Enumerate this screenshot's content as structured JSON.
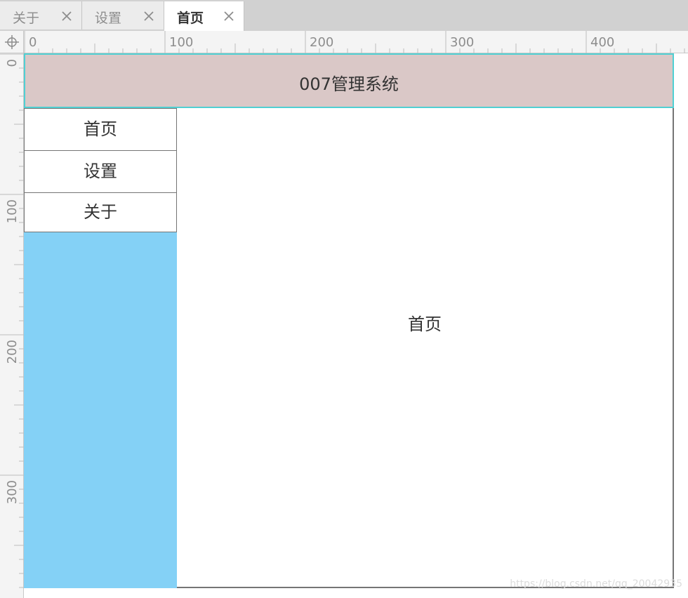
{
  "tabs": [
    {
      "label": "关于",
      "active": false
    },
    {
      "label": "设置",
      "active": false
    },
    {
      "label": "首页",
      "active": true
    }
  ],
  "ruler": {
    "horizontal_labels": [
      "0",
      "100",
      "200",
      "300",
      "400"
    ],
    "vertical_labels": [
      "0",
      "100",
      "200",
      "300"
    ]
  },
  "app": {
    "title": "007管理系统"
  },
  "sidebar": {
    "items": [
      {
        "label": "首页"
      },
      {
        "label": "设置"
      },
      {
        "label": "关于"
      }
    ]
  },
  "main": {
    "content": "首页"
  },
  "watermark": "https://blog.csdn.net/qq_20042935",
  "colors": {
    "header_bg": "#dac8c7",
    "header_border": "#4fd0d3",
    "sidebar_bg": "#84d1f6",
    "tabbar_bg": "#d1d1d1"
  },
  "icons": {
    "tab_close": "close-icon",
    "ruler_origin": "crosshair-icon"
  }
}
